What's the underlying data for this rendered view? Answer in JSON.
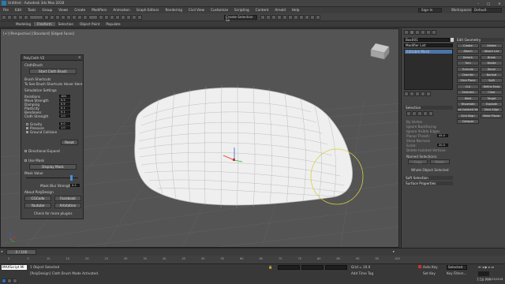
{
  "app": {
    "title": "Untitled - Autodesk 3ds Max 2018",
    "sign_in": "Sign In",
    "workspaces_label": "Workspaces:",
    "workspaces_value": "Default"
  },
  "menu": [
    "File",
    "Edit",
    "Tools",
    "Group",
    "Views",
    "Create",
    "Modifiers",
    "Animation",
    "Graph Editors",
    "Rendering",
    "Civil View",
    "Customize",
    "Scripting",
    "Content",
    "Arnold",
    "Help"
  ],
  "toolbar": {
    "selection_set": "Create Selection Se"
  },
  "ribbon_tabs": [
    "Modeling",
    "Freeform",
    "Selection",
    "Object Paint",
    "Populate"
  ],
  "viewport": {
    "label": "[+] [Perspective] [Standard] [Edged Faces]"
  },
  "dialog": {
    "title": "PolyCloth V2",
    "sections": {
      "cloth_brush": "ClothBrush",
      "start_button": "Start Cloth Brush",
      "brush_shortcuts": "Brush Shortcuts",
      "shortcut_hint": "To See Brush Shortcuts Hover Here",
      "simulation_settings": "Simulation Settings"
    },
    "params": [
      {
        "label": "Iterations",
        "value": "100"
      },
      {
        "label": "Move Strength",
        "value": "0.5"
      },
      {
        "label": "Damping",
        "value": "0.9"
      },
      {
        "label": "Plasticity",
        "value": "0.1"
      },
      {
        "label": "Bendiness",
        "value": "0.1"
      },
      {
        "label": "Cloth Strength",
        "value": "1.0"
      }
    ],
    "forces": [
      {
        "label": "Gravity",
        "value": "0.0",
        "checked": false
      },
      {
        "label": "Pressure",
        "value": "1.0",
        "checked": true
      },
      {
        "label": "Ground Collision",
        "value": "",
        "checked": true
      }
    ],
    "reset_button": "Reset",
    "directional_expand": "Directional Expand",
    "use_mask": "Use Mask",
    "display_mask_button": "Display Mask",
    "mask_value": "Mask Value",
    "mask_blur_label": "Mask Blur Strength",
    "mask_blur_value": "0.2",
    "about": "About PolyDesign",
    "links": [
      "CGCode",
      "Facebook",
      "Youtube",
      "Artstation"
    ],
    "footer": "Check for more plugins"
  },
  "command_panel": {
    "object_name": "Box001",
    "modifier_list": "Modifier List",
    "stack_item": "Editable Mesh",
    "rollouts": {
      "selection": "Selection",
      "soft_selection": "Soft Selection",
      "surface_properties": "Surface Properties",
      "edit_geometry": "Edit Geometry"
    },
    "selection_items": [
      "By Vertex",
      "Ignore Backfacing",
      "Ignore Visible Edges",
      "Planar Thresh:",
      "Show Normals",
      "Scale:",
      "Delete Isolated Vertices",
      "Named Selections:",
      "Copy",
      "Paste",
      "Whole Object Selected"
    ],
    "planar_value": "45.0",
    "scale_value": "20.0",
    "edit_geom_buttons": [
      "Create",
      "Delete",
      "Attach",
      "Attach List",
      "Detach",
      "Break",
      "Turn",
      "Divide",
      "Extrude",
      "Bevel",
      "Chamfer",
      "Normal",
      "Slice Plane",
      "Split",
      "Cut",
      "Refine Ends",
      "Selected",
      "Clear",
      "Weld",
      "Target",
      "Tessellate",
      "Explode",
      "Remove Isolated Vertices",
      "View Align",
      "Grid Align",
      "Make Planar",
      "Collapse"
    ],
    "weld_values": [
      "0.1",
      "4"
    ],
    "tessellate_value": "25.0",
    "explode_value": "24.0",
    "explode_opts": [
      "Objects",
      "Elements"
    ]
  },
  "timeline": {
    "frame": "0 / 100",
    "ticks": [
      "0",
      "5",
      "10",
      "15",
      "20",
      "25",
      "30",
      "35",
      "40",
      "45",
      "50",
      "55",
      "60",
      "65",
      "70",
      "75",
      "80",
      "85",
      "90",
      "95",
      "100"
    ]
  },
  "status": {
    "objects_selected": "1 Object Selected",
    "prompt": "[PolyDesign] Cloth Brush Mode Activated.",
    "maxscript": "MAXScript Mi",
    "grid": "Grid = 10.0",
    "add_time_tag": "Add Time Tag",
    "auto_key": "Auto Key",
    "set_key": "Set Key",
    "selected": "Selected",
    "key_filters": "Key Filters...",
    "clock": "7:50 PM",
    "date": "3/25/2018"
  }
}
